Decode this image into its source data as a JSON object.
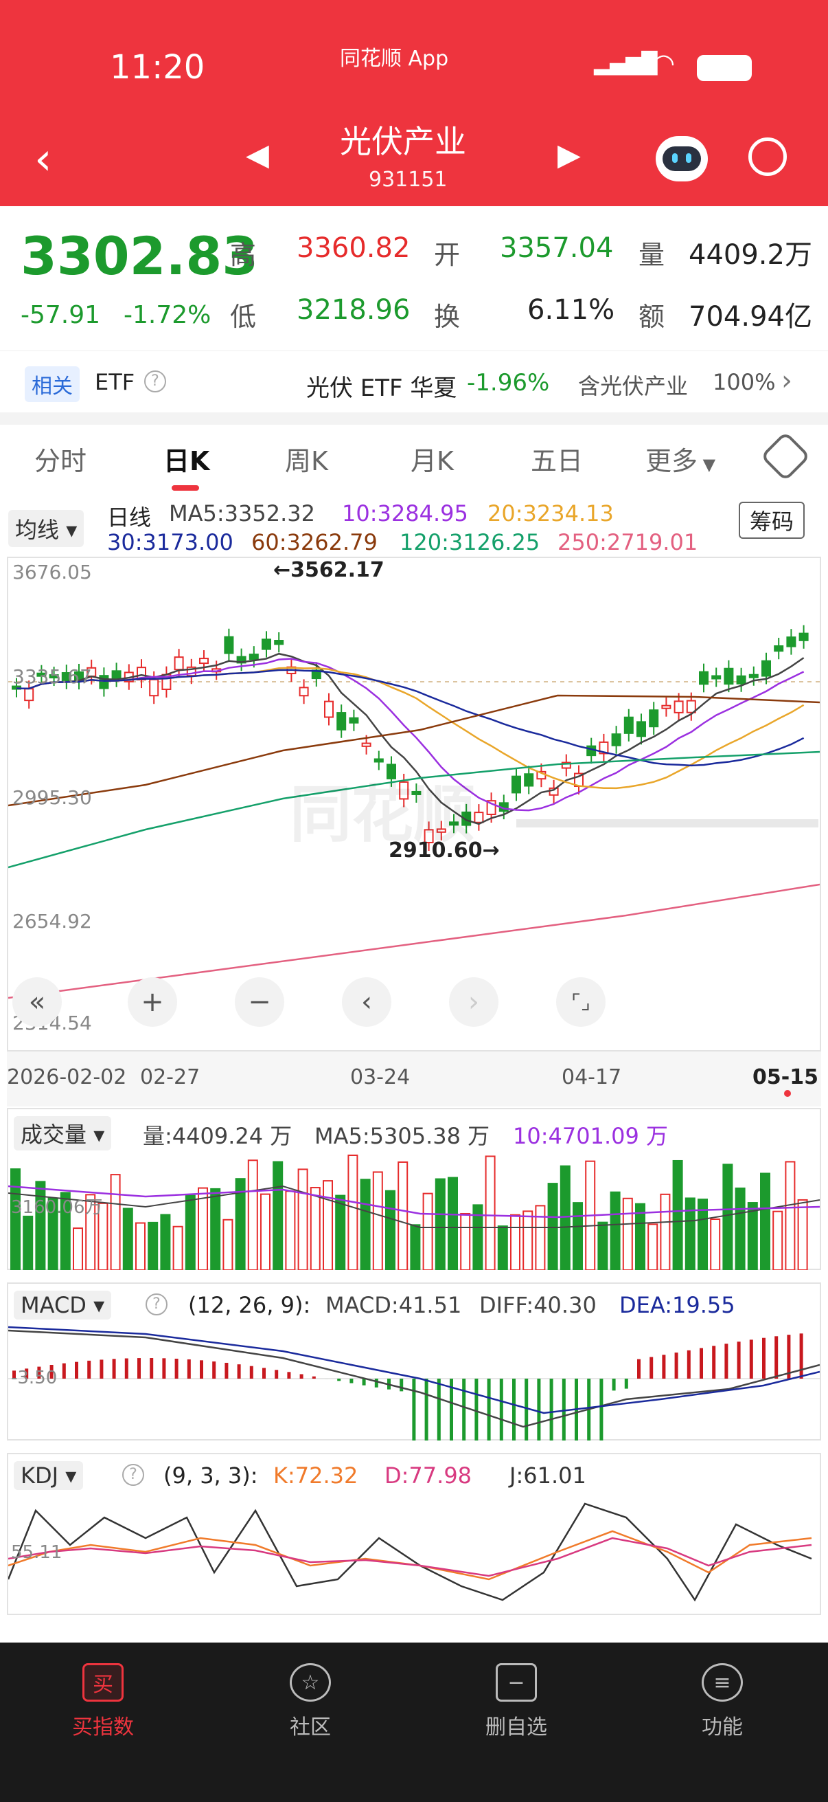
{
  "status_bar": {
    "time": "11:20",
    "app": "同花顺 App"
  },
  "header": {
    "title": "光伏产业",
    "code": "931151"
  },
  "quote": {
    "price": "3302.83",
    "change": "-57.91",
    "change_pct": "-1.72%",
    "high_label": "高",
    "high": "3360.82",
    "open_label": "开",
    "open": "3357.04",
    "vol_label": "量",
    "vol": "4409.2万",
    "low_label": "低",
    "low": "3218.96",
    "turn_label": "换",
    "turn": "6.11%",
    "amt_label": "额",
    "amt": "704.94亿"
  },
  "related": {
    "tag": "相关",
    "etf": "ETF",
    "fund": "光伏 ETF 华夏",
    "fund_chg": "-1.96%",
    "contains": "含光伏产业",
    "pct": "100%"
  },
  "tabs": [
    "分时",
    "日K",
    "周K",
    "月K",
    "五日",
    "更多"
  ],
  "kline": {
    "ma_dropdown": "均线",
    "title": "日线",
    "ma5": "MA5:3352.32",
    "ma10": "10:3284.95",
    "ma20": "20:3234.13",
    "ma30": "30:3173.00",
    "ma60": "60:3262.79",
    "ma120": "120:3126.25",
    "ma250": "250:2719.01",
    "chips_btn": "筹码",
    "y_ticks": [
      "3676.05",
      "3335.67",
      "2995.30",
      "2654.92",
      "2314.54"
    ],
    "high_mark": "←3562.17",
    "low_mark": "2910.60→",
    "x_ticks": [
      "2026-02-02",
      "02-27",
      "03-24",
      "04-17",
      "05-15"
    ],
    "watermark": "同花顺"
  },
  "volume": {
    "dropdown": "成交量",
    "vol": "量:4409.24 万",
    "ma5": "MA5:5305.38 万",
    "ma10": "10:4701.09 万",
    "y_tick": "3160.06万"
  },
  "macd": {
    "dropdown": "MACD",
    "params": "(12, 26, 9):",
    "macd": "MACD:41.51",
    "diff": "DIFF:40.30",
    "dea": "DEA:19.55",
    "y_tick": "-3.50"
  },
  "kdj": {
    "dropdown": "KDJ",
    "params": "(9, 3, 3):",
    "k": "K:72.32",
    "d": "D:77.98",
    "j": "J:61.01",
    "y_tick": "55.11"
  },
  "bottom_nav": [
    "买指数",
    "社区",
    "删自选",
    "功能"
  ],
  "colors": {
    "header": "#ee343e",
    "up": "#e62b2b",
    "down": "#1c9a2d"
  }
}
